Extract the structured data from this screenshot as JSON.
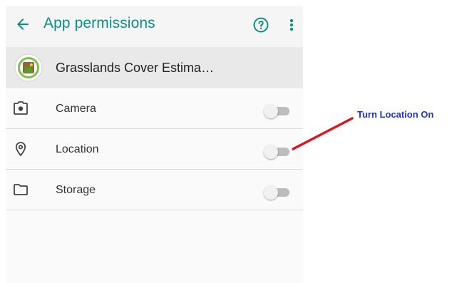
{
  "appbar": {
    "title": "App permissions",
    "back_icon": "arrow-back-icon",
    "help_icon": "help-circle-icon",
    "more_icon": "more-vert-icon",
    "title_color": "#0b8f7e"
  },
  "app": {
    "name": "Grasslands Cover Estima…",
    "icon": "app-logo-icon"
  },
  "permissions": [
    {
      "label": "Camera",
      "icon": "camera-icon",
      "enabled": false
    },
    {
      "label": "Location",
      "icon": "location-pin-icon",
      "enabled": false
    },
    {
      "label": "Storage",
      "icon": "folder-icon",
      "enabled": false
    }
  ],
  "annotation": {
    "text": "Turn Location On",
    "text_color": "#2233cc",
    "arrow_color": "#e0141e"
  }
}
